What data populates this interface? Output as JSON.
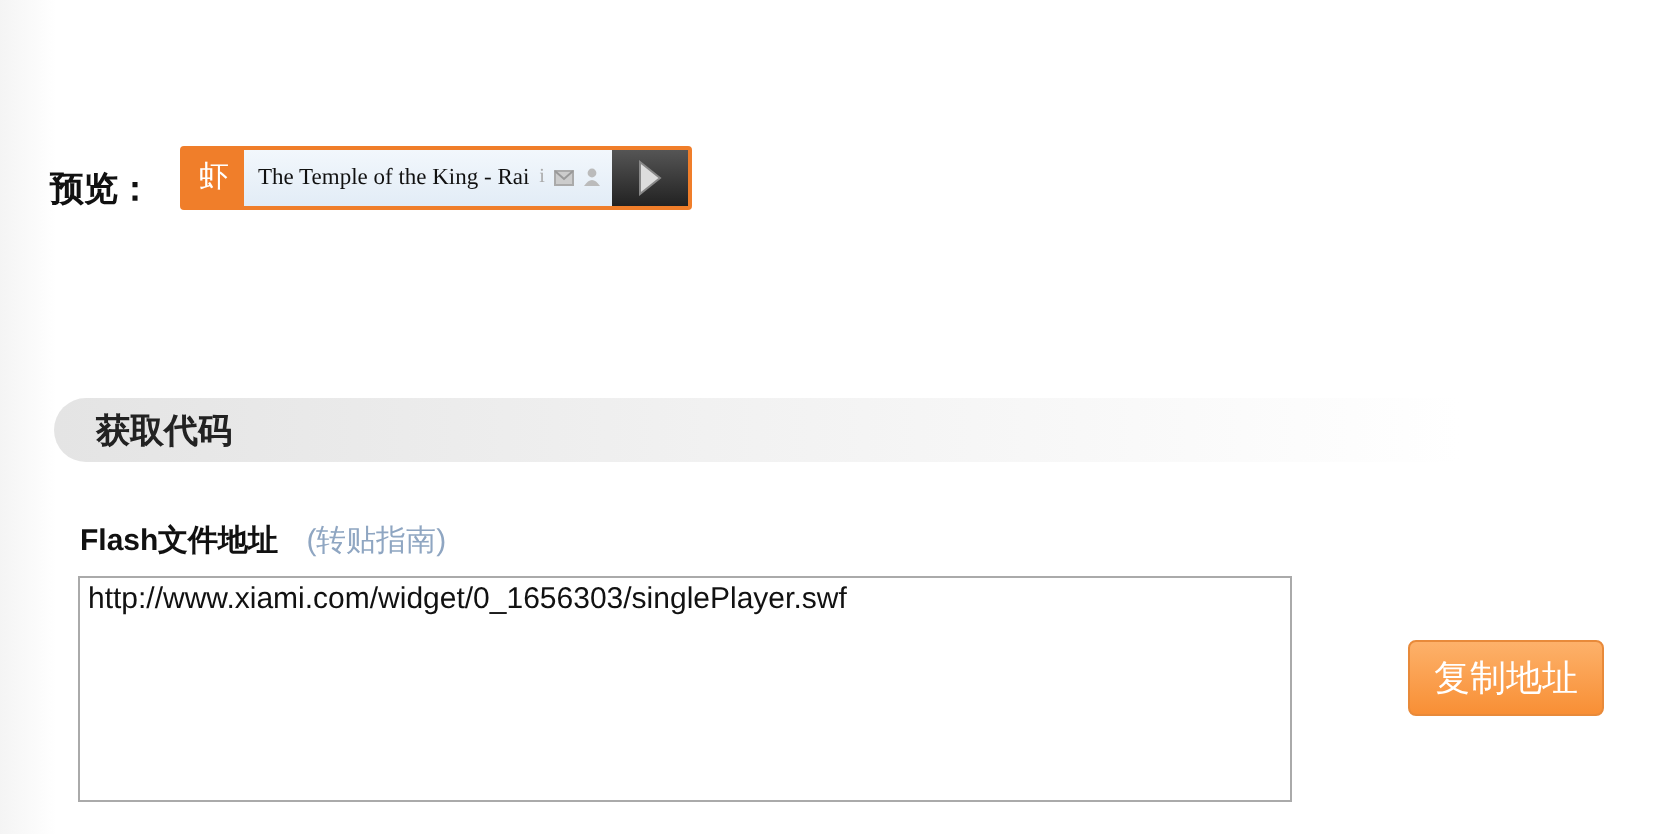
{
  "preview": {
    "label": "预览：",
    "player": {
      "logo": "虾",
      "title": "The Temple of the King - Rai",
      "info": "i"
    }
  },
  "section": {
    "title": "获取代码"
  },
  "field": {
    "label": "Flash文件地址",
    "link": "(转贴指南)",
    "value": "http://www.xiami.com/widget/0_1656303/singlePlayer.swf"
  },
  "buttons": [
    "复制地址"
  ]
}
